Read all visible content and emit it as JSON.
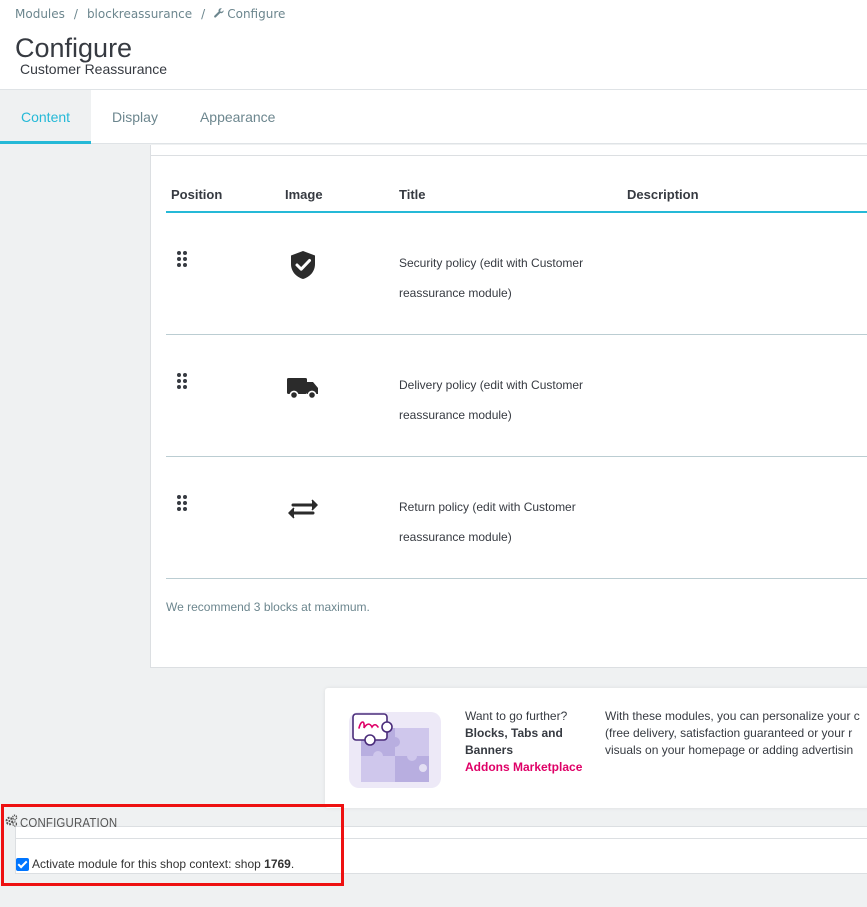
{
  "breadcrumb": {
    "items": [
      "Modules",
      "blockreassurance"
    ],
    "current": "Configure",
    "separator": "/"
  },
  "page": {
    "title": "Configure",
    "subtitle": "Customer Reassurance"
  },
  "tabs": [
    {
      "label": "Content",
      "active": true
    },
    {
      "label": "Display",
      "active": false
    },
    {
      "label": "Appearance",
      "active": false
    }
  ],
  "table": {
    "headers": [
      "Position",
      "Image",
      "Title",
      "Description"
    ],
    "rows": [
      {
        "icon": "shield-check-icon",
        "title": "Security policy (edit with Customer reassurance module)",
        "description": ""
      },
      {
        "icon": "truck-icon",
        "title": "Delivery policy (edit with Customer reassurance module)",
        "description": ""
      },
      {
        "icon": "swap-arrows-icon",
        "title": "Return policy (edit with Customer reassurance module)",
        "description": ""
      }
    ],
    "recommendation": "We recommend 3 blocks at maximum."
  },
  "addons": {
    "intro": "Want to go further?",
    "bold": "Blocks, Tabs and Banners",
    "link": "Addons Marketplace",
    "text_lines": [
      "With these modules, you can personalize your c",
      "(free delivery, satisfaction guaranteed or your r",
      "visuals on your homepage or adding advertisin"
    ]
  },
  "configuration": {
    "heading": "CONFIGURATION",
    "checkbox_label": "Activate module for this shop context: shop",
    "shop_id": "1769",
    "trailing": ".",
    "checked": true
  },
  "colors": {
    "accent": "#25b9d7",
    "link": "#df0067",
    "highlight": "#ee1111"
  }
}
